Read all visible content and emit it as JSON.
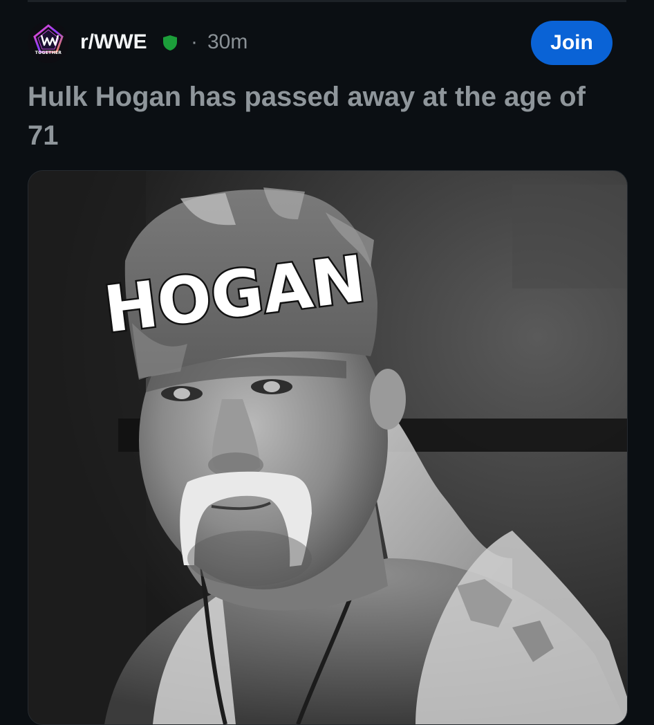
{
  "subreddit": {
    "name": "r/WWE",
    "avatar_icon": "wwe-logo-icon",
    "avatar_caption": "TOGETHER",
    "mod_badge_icon": "green-shield-icon",
    "separator": "·",
    "time_ago": "30m"
  },
  "actions": {
    "join_label": "Join"
  },
  "post": {
    "title": "Hulk Hogan has passed away at the age of 71",
    "image": {
      "headband_text": "HOGAN"
    }
  },
  "colors": {
    "background": "#0b0f13",
    "join_button": "#0a63d6",
    "mod_badge": "#1c9e3a",
    "title_text": "#8f969b"
  }
}
